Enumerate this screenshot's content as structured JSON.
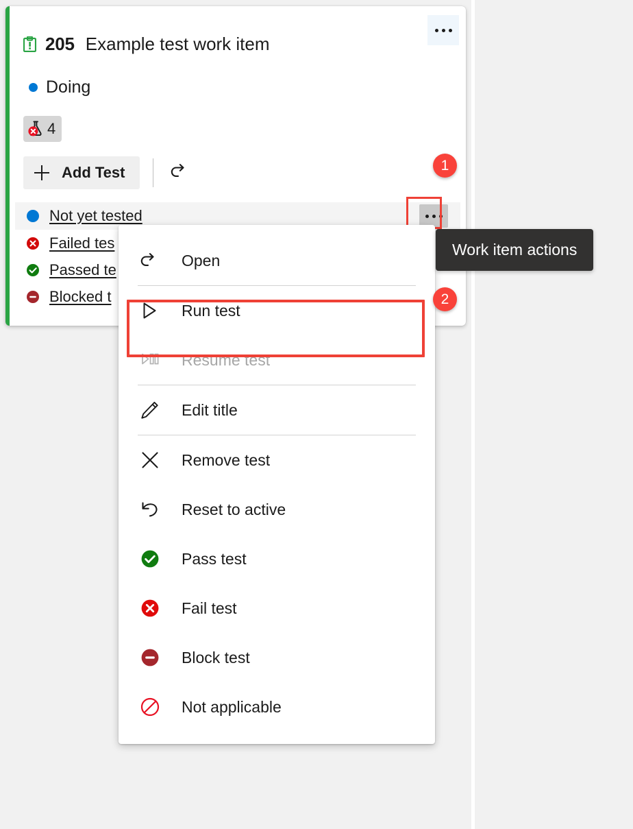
{
  "card": {
    "work_item_icon": "task-clipboard-icon",
    "id": "205",
    "title": "Example test work item",
    "state": "Doing",
    "state_color": "#0078d4",
    "accent_color": "#2aa444",
    "card_menu_icon": "ellipsis-icon"
  },
  "counter": {
    "icon": "failed-beaker-icon",
    "value": "4"
  },
  "toolbar": {
    "add_test_label": "Add Test",
    "add_test_icon": "plus-icon",
    "open_icon": "open-arrow-icon"
  },
  "tests": [
    {
      "name": "Not yet tested",
      "status": "not-run",
      "status_icon": "blue-circle-icon",
      "color": "#0078d4",
      "hovered": true
    },
    {
      "name": "Failed tes",
      "status": "failed",
      "status_icon": "fail-circle-icon",
      "color": "#d20a0a",
      "hovered": false
    },
    {
      "name": "Passed te",
      "status": "passed",
      "status_icon": "pass-circle-icon",
      "color": "#107c10",
      "hovered": false
    },
    {
      "name": "Blocked t",
      "status": "blocked",
      "status_icon": "block-circle-icon",
      "color": "#a4262c",
      "hovered": false
    }
  ],
  "row_menu": {
    "icon": "ellipsis-icon"
  },
  "context_menu": {
    "items": [
      {
        "label": "Open",
        "icon": "open-arrow-icon",
        "disabled": false,
        "icon_color": "#1b1b1b"
      },
      {
        "label": "Run test",
        "icon": "play-icon",
        "disabled": false,
        "icon_color": "#1b1b1b"
      },
      {
        "label": "Resume test",
        "icon": "play-pause-icon",
        "disabled": true,
        "icon_color": "#a6a6a6"
      },
      {
        "label": "Edit title",
        "icon": "pencil-icon",
        "disabled": false,
        "icon_color": "#1b1b1b"
      },
      {
        "label": "Remove test",
        "icon": "close-x-icon",
        "disabled": false,
        "icon_color": "#1b1b1b"
      },
      {
        "label": "Reset to active",
        "icon": "undo-arrow-icon",
        "disabled": false,
        "icon_color": "#1b1b1b"
      },
      {
        "label": "Pass test",
        "icon": "pass-circle-icon",
        "disabled": false,
        "icon_color": "#107c10"
      },
      {
        "label": "Fail test",
        "icon": "fail-circle-icon",
        "disabled": false,
        "icon_color": "#d20a0a"
      },
      {
        "label": "Block test",
        "icon": "block-circle-icon",
        "disabled": false,
        "icon_color": "#a4262c"
      },
      {
        "label": "Not applicable",
        "icon": "not-allowed-icon",
        "disabled": false,
        "icon_color": "#e81123"
      }
    ]
  },
  "tooltip": {
    "text": "Work item actions"
  },
  "callouts": [
    {
      "number": "1"
    },
    {
      "number": "2"
    }
  ],
  "colors": {
    "highlight": "#ef4136",
    "badge": "#f9423a",
    "tooltip_bg": "#323130"
  }
}
